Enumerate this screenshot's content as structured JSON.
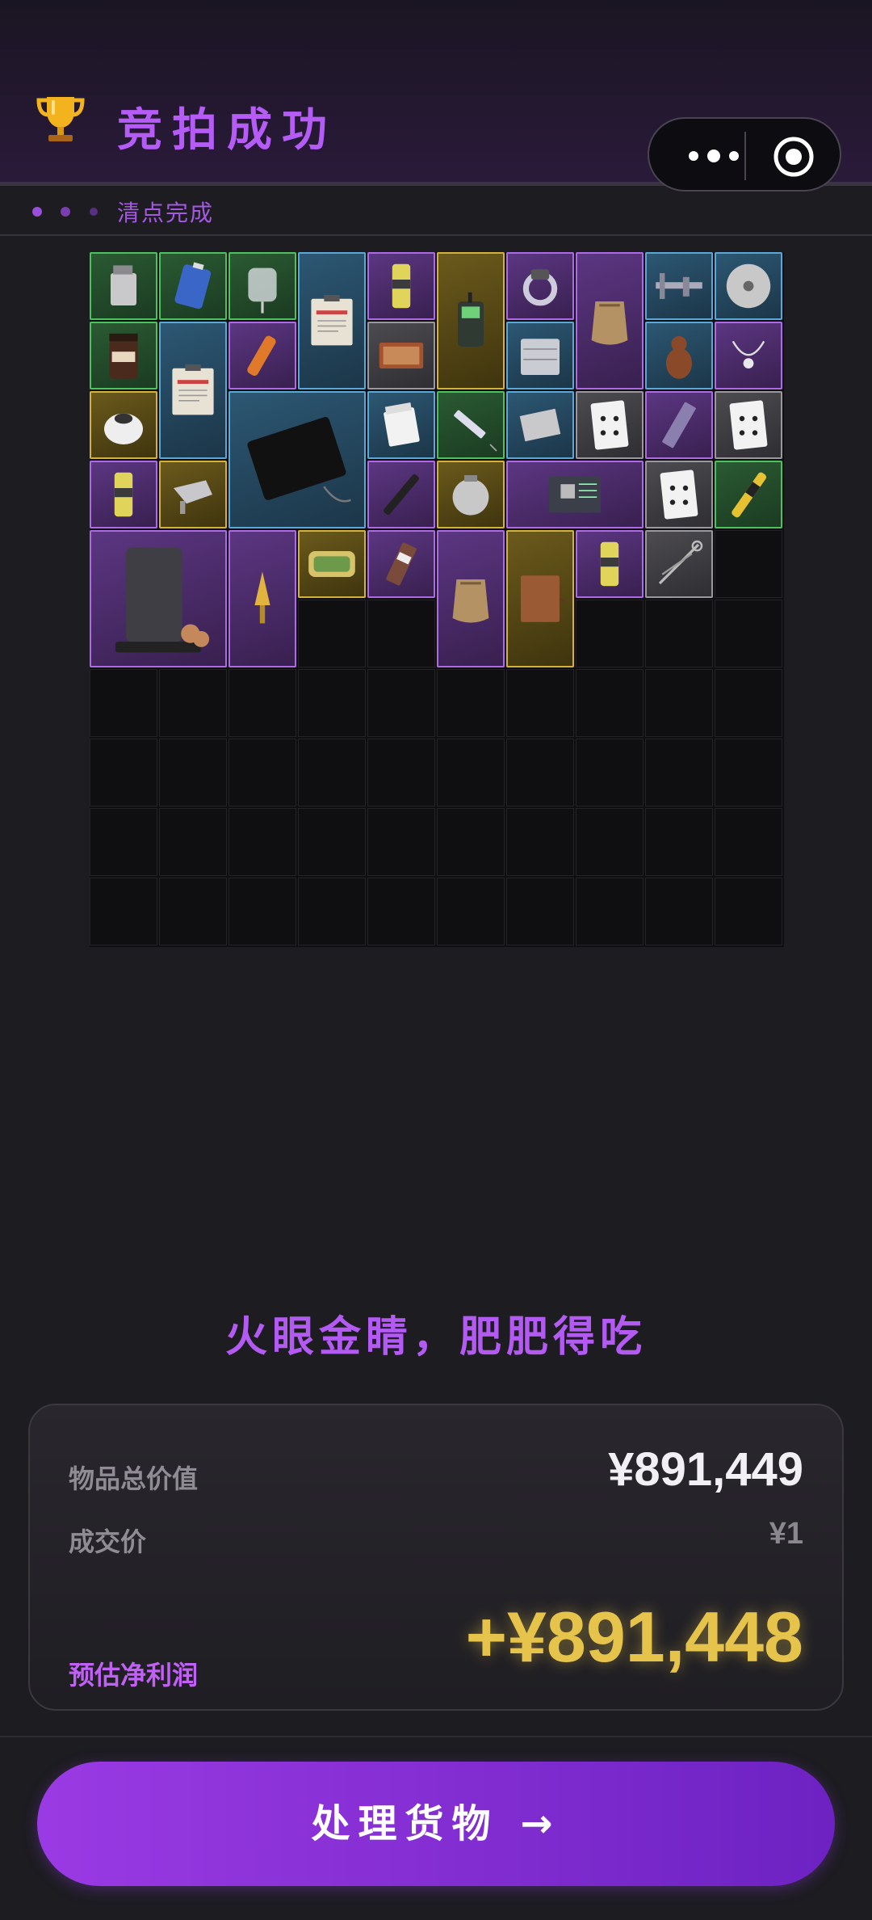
{
  "header": {
    "title": "竞拍成功",
    "trophy_icon": "trophy-icon",
    "menu_icon": "more-dots-icon",
    "close_icon": "target-circle-icon"
  },
  "status": {
    "text": "清点完成"
  },
  "slogan": "火眼金睛，肥肥得吃",
  "summary": {
    "total_label": "物品总价值",
    "total_value": "¥891,449",
    "price_label": "成交价",
    "price_value": "¥1",
    "profit_label": "预估净利润",
    "profit_value": "+¥891,448"
  },
  "action": {
    "label": "处理货物 →"
  },
  "colors": {
    "accent_purple": "#b45cf5",
    "profit_gold": "#e6c34a",
    "green": "#4cc25e",
    "blue": "#5aa8d8",
    "purple": "#ae6ae6",
    "gold": "#d4b23a",
    "gray": "#9a989e"
  },
  "inventory": {
    "columns": 10,
    "rows": 10,
    "items": [
      {
        "c": 0,
        "r": 0,
        "w": 1,
        "h": 1,
        "rarity": "green",
        "icon": "lighter-icon"
      },
      {
        "c": 1,
        "r": 0,
        "w": 1,
        "h": 1,
        "rarity": "green",
        "icon": "battery-icon"
      },
      {
        "c": 2,
        "r": 0,
        "w": 1,
        "h": 1,
        "rarity": "green",
        "icon": "iv-bag-icon"
      },
      {
        "c": 3,
        "r": 0,
        "w": 1,
        "h": 2,
        "rarity": "blue",
        "icon": "confidential-clipboard-icon"
      },
      {
        "c": 4,
        "r": 0,
        "w": 1,
        "h": 1,
        "rarity": "purple",
        "icon": "energy-drink-icon"
      },
      {
        "c": 5,
        "r": 0,
        "w": 1,
        "h": 2,
        "rarity": "gold",
        "icon": "satellite-phone-icon"
      },
      {
        "c": 6,
        "r": 0,
        "w": 1,
        "h": 1,
        "rarity": "purple",
        "icon": "ring-icon"
      },
      {
        "c": 7,
        "r": 0,
        "w": 1,
        "h": 2,
        "rarity": "purple",
        "icon": "sack-icon"
      },
      {
        "c": 8,
        "r": 0,
        "w": 1,
        "h": 1,
        "rarity": "blue",
        "icon": "caliper-icon"
      },
      {
        "c": 9,
        "r": 0,
        "w": 1,
        "h": 1,
        "rarity": "blue",
        "icon": "disc-icon"
      },
      {
        "c": 0,
        "r": 1,
        "w": 1,
        "h": 1,
        "rarity": "green",
        "icon": "coffee-jar-icon"
      },
      {
        "c": 1,
        "r": 1,
        "w": 1,
        "h": 2,
        "rarity": "blue",
        "icon": "confidential-clipboard-icon"
      },
      {
        "c": 2,
        "r": 1,
        "w": 1,
        "h": 1,
        "rarity": "purple",
        "icon": "flare-icon"
      },
      {
        "c": 4,
        "r": 1,
        "w": 1,
        "h": 1,
        "rarity": "gray",
        "icon": "matchbox-icon"
      },
      {
        "c": 6,
        "r": 1,
        "w": 1,
        "h": 1,
        "rarity": "blue",
        "icon": "hard-drive-icon"
      },
      {
        "c": 8,
        "r": 1,
        "w": 1,
        "h": 1,
        "rarity": "blue",
        "icon": "figurine-icon"
      },
      {
        "c": 9,
        "r": 1,
        "w": 1,
        "h": 1,
        "rarity": "purple",
        "icon": "necklace-icon"
      },
      {
        "c": 0,
        "r": 2,
        "w": 1,
        "h": 1,
        "rarity": "gold",
        "icon": "gas-filter-icon"
      },
      {
        "c": 2,
        "r": 2,
        "w": 2,
        "h": 2,
        "rarity": "blue",
        "icon": "tablet-screen-icon"
      },
      {
        "c": 4,
        "r": 2,
        "w": 1,
        "h": 1,
        "rarity": "blue",
        "icon": "cigarette-pack-icon"
      },
      {
        "c": 5,
        "r": 2,
        "w": 1,
        "h": 1,
        "rarity": "green",
        "icon": "syringe-icon"
      },
      {
        "c": 6,
        "r": 2,
        "w": 1,
        "h": 1,
        "rarity": "blue",
        "icon": "cpu-chip-icon"
      },
      {
        "c": 7,
        "r": 2,
        "w": 1,
        "h": 1,
        "rarity": "gray",
        "icon": "playing-card-icon"
      },
      {
        "c": 8,
        "r": 2,
        "w": 1,
        "h": 1,
        "rarity": "purple",
        "icon": "memory-stick-icon"
      },
      {
        "c": 9,
        "r": 2,
        "w": 1,
        "h": 1,
        "rarity": "gray",
        "icon": "playing-card-icon"
      },
      {
        "c": 0,
        "r": 3,
        "w": 1,
        "h": 1,
        "rarity": "purple",
        "icon": "energy-drink-icon"
      },
      {
        "c": 1,
        "r": 3,
        "w": 1,
        "h": 1,
        "rarity": "gold",
        "icon": "drone-part-icon"
      },
      {
        "c": 4,
        "r": 3,
        "w": 1,
        "h": 1,
        "rarity": "purple",
        "icon": "fountain-pen-icon"
      },
      {
        "c": 5,
        "r": 3,
        "w": 1,
        "h": 1,
        "rarity": "gold",
        "icon": "pacemaker-icon"
      },
      {
        "c": 6,
        "r": 3,
        "w": 2,
        "h": 1,
        "rarity": "purple",
        "icon": "circuit-board-icon"
      },
      {
        "c": 8,
        "r": 3,
        "w": 1,
        "h": 1,
        "rarity": "gray",
        "icon": "playing-card-icon"
      },
      {
        "c": 9,
        "r": 3,
        "w": 1,
        "h": 1,
        "rarity": "green",
        "icon": "multimeter-pen-icon"
      },
      {
        "c": 0,
        "r": 4,
        "w": 2,
        "h": 2,
        "rarity": "purple",
        "icon": "coffee-machine-icon"
      },
      {
        "c": 2,
        "r": 4,
        "w": 1,
        "h": 2,
        "rarity": "purple",
        "icon": "golden-dagger-icon"
      },
      {
        "c": 3,
        "r": 4,
        "w": 1,
        "h": 1,
        "rarity": "gold",
        "icon": "sardine-tin-icon"
      },
      {
        "c": 4,
        "r": 4,
        "w": 1,
        "h": 1,
        "rarity": "purple",
        "icon": "snack-bar-icon"
      },
      {
        "c": 5,
        "r": 4,
        "w": 1,
        "h": 2,
        "rarity": "purple",
        "icon": "sack-icon"
      },
      {
        "c": 6,
        "r": 4,
        "w": 1,
        "h": 2,
        "rarity": "gold",
        "icon": "leather-journal-icon"
      },
      {
        "c": 7,
        "r": 4,
        "w": 1,
        "h": 1,
        "rarity": "purple",
        "icon": "energy-drink-icon"
      },
      {
        "c": 8,
        "r": 4,
        "w": 1,
        "h": 1,
        "rarity": "gray",
        "icon": "scissors-icon"
      }
    ]
  }
}
